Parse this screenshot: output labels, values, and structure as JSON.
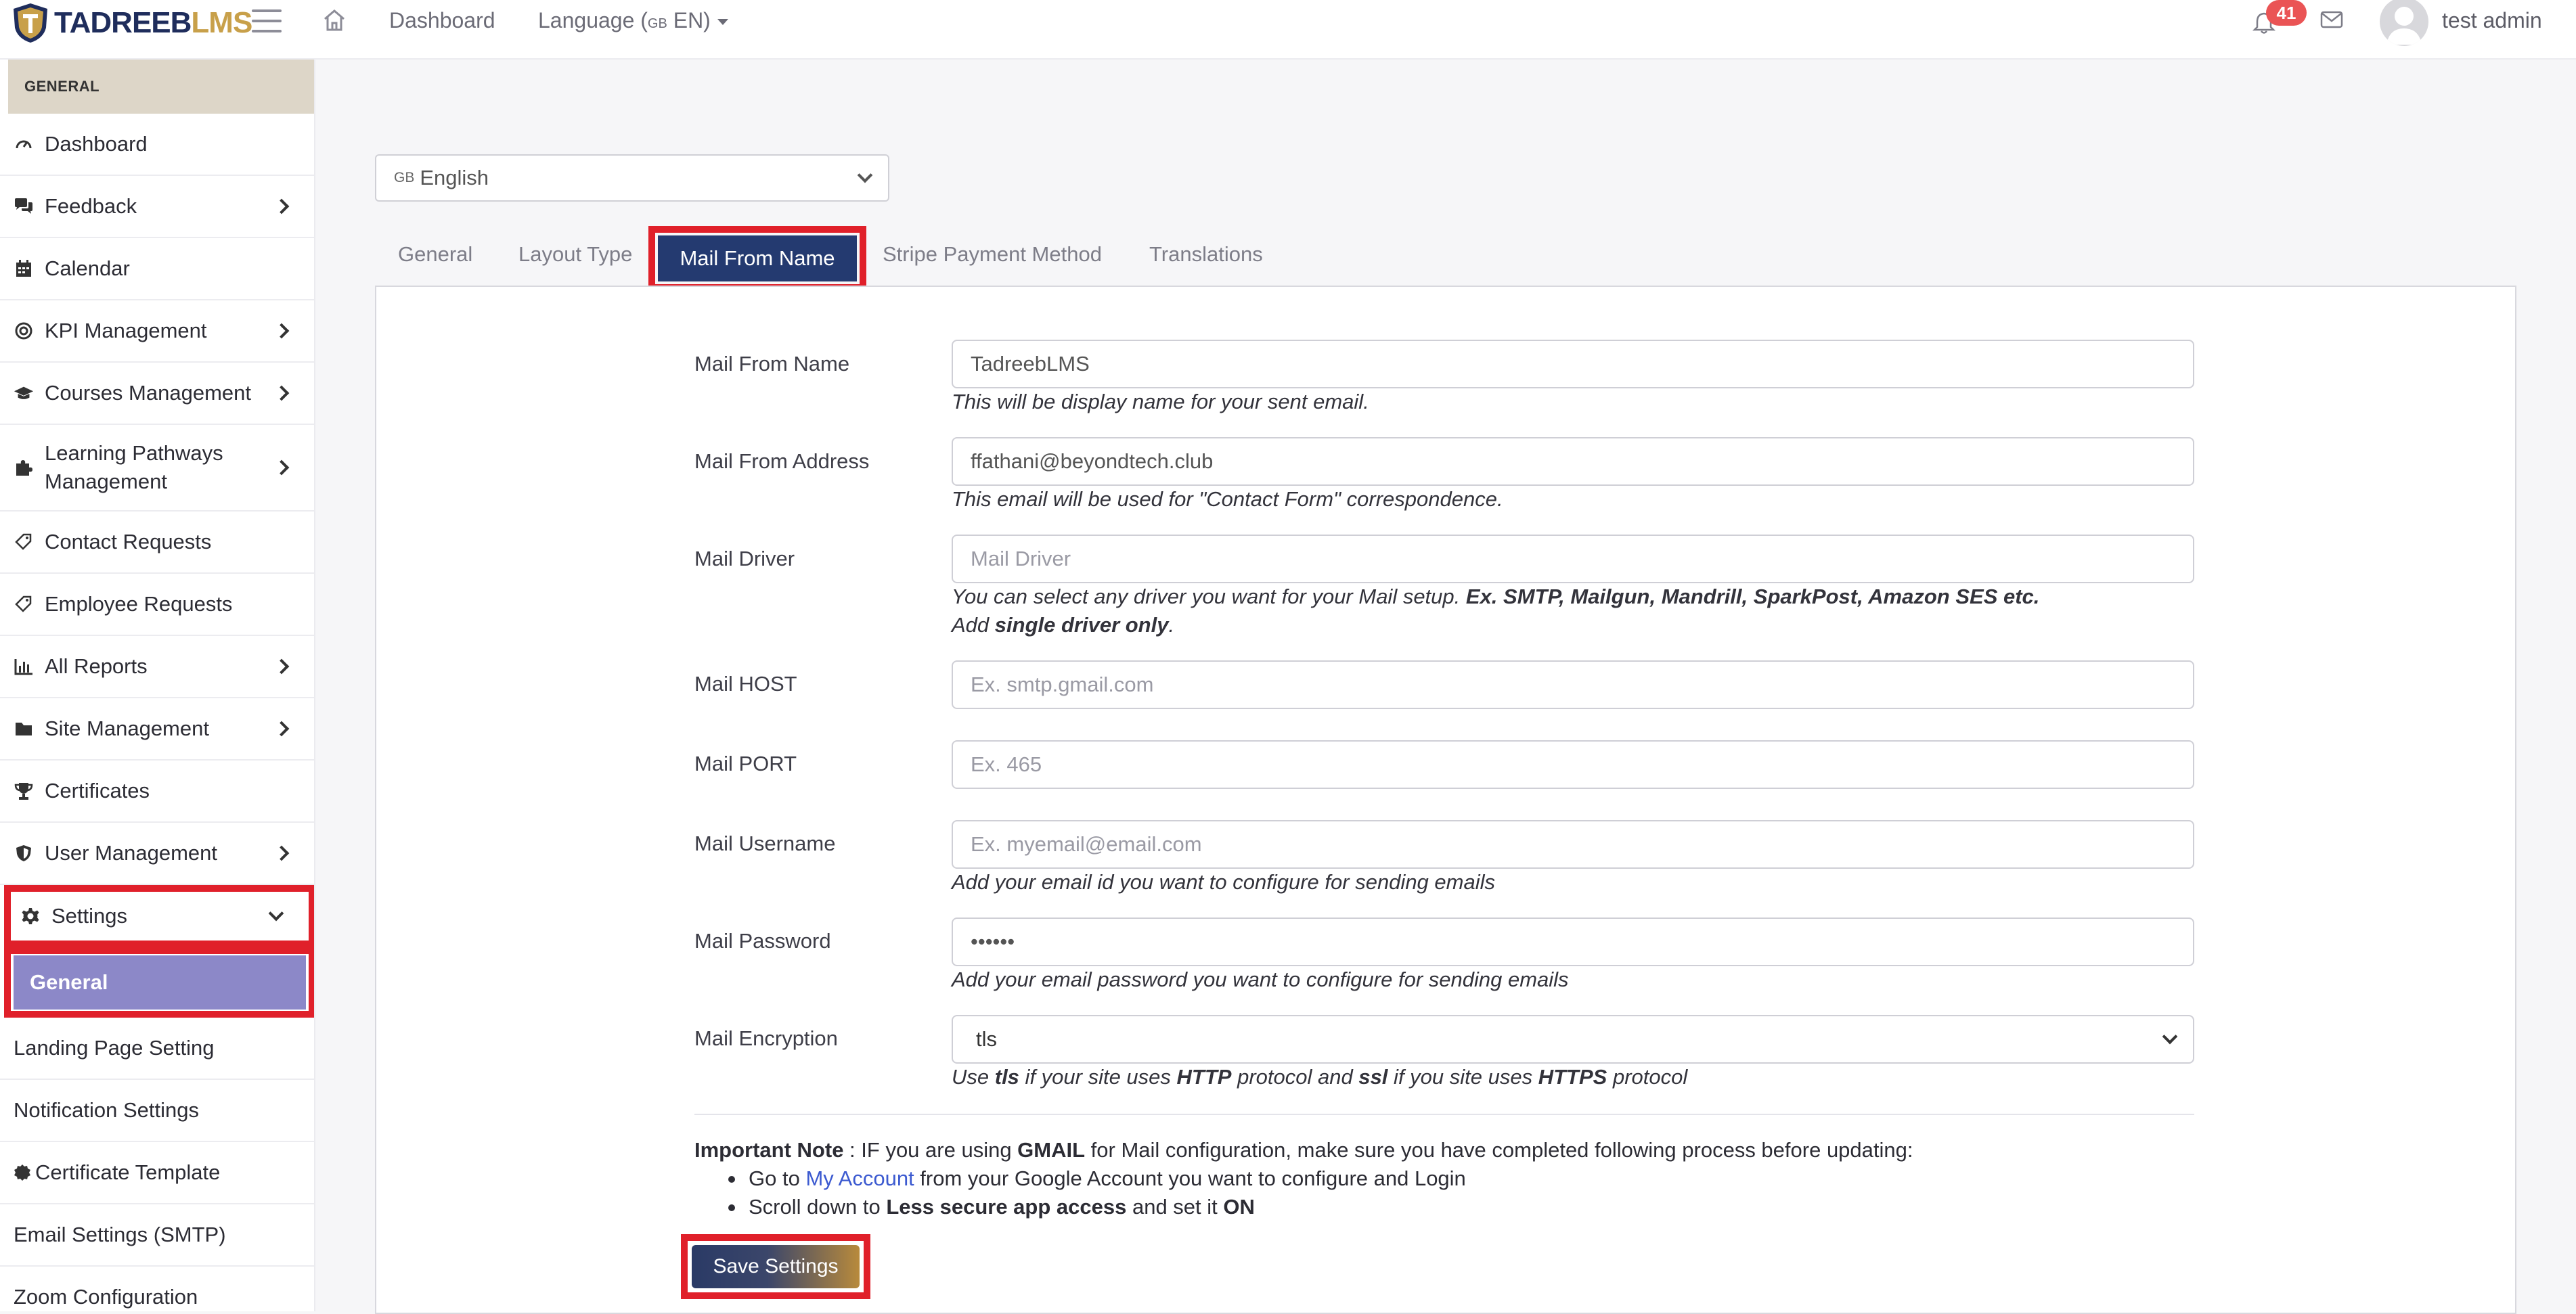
{
  "header": {
    "brand_a": "TADREEB",
    "brand_b": "LMS",
    "dashboard_link": "Dashboard",
    "language_label": "Language (",
    "language_flag": "GB",
    "language_code": " EN)",
    "notification_count": "41",
    "user_name": "test admin"
  },
  "sidebar": {
    "section_title": "GENERAL",
    "items": [
      {
        "label": "Dashboard",
        "icon": "dashboard-icon",
        "chevron": false
      },
      {
        "label": "Feedback",
        "icon": "comments-icon",
        "chevron": true
      },
      {
        "label": "Calendar",
        "icon": "calendar-icon",
        "chevron": false
      },
      {
        "label": "KPI Management",
        "icon": "target-icon",
        "chevron": true
      },
      {
        "label": "Courses Management",
        "icon": "graduation-cap-icon",
        "chevron": true
      },
      {
        "label": "Learning Pathways Management",
        "icon": "puzzle-icon",
        "chevron": true
      },
      {
        "label": "Contact Requests",
        "icon": "tag-icon",
        "chevron": false
      },
      {
        "label": "Employee Requests",
        "icon": "tag-icon",
        "chevron": false
      },
      {
        "label": "All Reports",
        "icon": "bar-chart-icon",
        "chevron": true
      },
      {
        "label": "Site Management",
        "icon": "folder-icon",
        "chevron": true
      },
      {
        "label": "Certificates",
        "icon": "trophy-icon",
        "chevron": false
      },
      {
        "label": "User Management",
        "icon": "shield-icon",
        "chevron": true
      },
      {
        "label": "Settings",
        "icon": "gear-icon",
        "chevron": true
      }
    ],
    "settings_sub_active": "General",
    "settings_sub_items": [
      "Landing Page Setting",
      "Notification Settings",
      "Certificate Template",
      "Email Settings (SMTP)",
      "Zoom Configuration"
    ]
  },
  "language_select": {
    "flag": "GB",
    "value": "English"
  },
  "tabs": [
    "General",
    "Layout Type",
    "Mail From Name",
    "Stripe Payment Method",
    "Translations"
  ],
  "active_tab": "Mail From Name",
  "form": {
    "mail_from_name": {
      "label": "Mail From Name",
      "value": "TadreebLMS",
      "help": "This will be display name for your sent email."
    },
    "mail_from_address": {
      "label": "Mail From Address",
      "value": "ffathani@beyondtech.club",
      "help": "This email will be used for \"Contact Form\" correspondence."
    },
    "mail_driver": {
      "label": "Mail Driver",
      "placeholder": "Mail Driver",
      "help_a": "You can select any driver you want for your Mail setup. ",
      "help_b": "Ex. SMTP, Mailgun, Mandrill, SparkPost, Amazon SES etc.",
      "help_c": "Add ",
      "help_d": "single driver only",
      "help_e": "."
    },
    "mail_host": {
      "label": "Mail HOST",
      "placeholder": "Ex. smtp.gmail.com"
    },
    "mail_port": {
      "label": "Mail PORT",
      "placeholder": "Ex. 465"
    },
    "mail_username": {
      "label": "Mail Username",
      "placeholder": "Ex. myemail@email.com",
      "help": "Add your email id you want to configure for sending emails"
    },
    "mail_password": {
      "label": "Mail Password",
      "value": "••••••",
      "help": "Add your email password you want to configure for sending emails"
    },
    "mail_encryption": {
      "label": "Mail Encryption",
      "value": "tls",
      "help_a": "Use ",
      "help_b": "tls",
      "help_c": " if your site uses ",
      "help_d": "HTTP",
      "help_e": " protocol and ",
      "help_f": "ssl",
      "help_g": " if you site uses ",
      "help_h": "HTTPS",
      "help_i": " protocol"
    }
  },
  "note": {
    "title": "Important Note",
    "text_a": " : IF you are using ",
    "gmail": "GMAIL",
    "text_b": " for Mail configuration, make sure you have completed following process before updating:",
    "step1_a": "Go to ",
    "step1_link": "My Account",
    "step1_b": " from your Google Account you want to configure and Login",
    "step2_a": "Scroll down to ",
    "step2_b": "Less secure app access",
    "step2_c": " and set it ",
    "step2_d": "ON"
  },
  "save_button": "Save Settings",
  "colors": {
    "accent": "#243a70",
    "highlight": "#e0202a",
    "sub_active": "#8c88c8",
    "badge": "#ea5455"
  }
}
